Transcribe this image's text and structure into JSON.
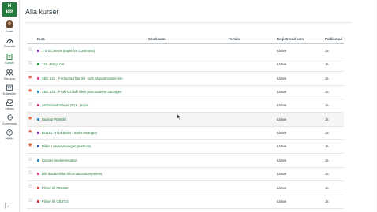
{
  "logo": {
    "line1": "H",
    "line2": "KR"
  },
  "nav": [
    {
      "name": "account",
      "label": "Konto"
    },
    {
      "name": "dashboard",
      "label": "Översikt"
    },
    {
      "name": "courses",
      "label": "Kurser"
    },
    {
      "name": "groups",
      "label": "Grupper"
    },
    {
      "name": "calendar",
      "label": "Kalender"
    },
    {
      "name": "inbox",
      "label": "Inkorg"
    },
    {
      "name": "commons",
      "label": "Commons"
    },
    {
      "name": "help",
      "label": "Hjälp"
    }
  ],
  "collapse_glyph": "|←",
  "page_title": "Alla kurser",
  "columns": {
    "course": "Kurs",
    "nickname": "Smeknamn",
    "term": "Termin",
    "enrolled_as": "Registrerad som",
    "published": "Publicerad"
  },
  "colors": {
    "accent": "#26793c",
    "star_on": "#e66135",
    "star_off": "#73818c"
  },
  "courses": [
    {
      "name": "1-2-3 Canvas (kopia för Commons)",
      "role": "Lärare",
      "published": "Ja",
      "favorite": false,
      "color": "#8f3fb3"
    },
    {
      "name": "123 - Börja här",
      "role": "Lärare",
      "published": "Ja",
      "favorite": false,
      "color": "#33a14c"
    },
    {
      "name": "ABC 121 - Förändrad framtid - och kärpostmodernism",
      "role": "Lärare",
      "published": "Ja",
      "favorite": true,
      "color": "#e5468e"
    },
    {
      "name": "ABC 123 - Frukt och kål i den postmoderna vardagen",
      "role": "Lärare",
      "published": "Ja",
      "favorite": true,
      "color": "#2f8fc9"
    },
    {
      "name": "Ambassadörskurs 2018 - kopia",
      "role": "Lärare",
      "published": "Ja",
      "favorite": false,
      "color": "#d94a8a"
    },
    {
      "name": "Backup FE693U",
      "role": "Lärare",
      "published": "Ja",
      "favorite": true,
      "color": "#2f8fc9"
    },
    {
      "name": "BI1202 HT18 Bilder i undervisningen",
      "role": "Lärare",
      "published": "Ja",
      "favorite": true,
      "color": "#8f3fb3"
    },
    {
      "name": "Bilder i undervisningen (testkurs)",
      "role": "Lärare",
      "published": "Ja",
      "favorite": true,
      "color": "#3b5fc4"
    },
    {
      "name": "Canvas implementation",
      "role": "Lärare",
      "published": "Ja",
      "favorite": false,
      "color": "#2f8fc9"
    },
    {
      "name": "Din akademiska informationskompetens",
      "role": "Lärare",
      "published": "Ja",
      "favorite": false,
      "color": "#e5468e"
    },
    {
      "name": "Filmer till FE6332",
      "role": "Lärare",
      "published": "Ja",
      "favorite": false,
      "color": "#d93a3a"
    },
    {
      "name": "Filmer till GE8721",
      "role": "Lärare",
      "published": "Ja",
      "favorite": false,
      "color": "#d93a3a"
    }
  ]
}
